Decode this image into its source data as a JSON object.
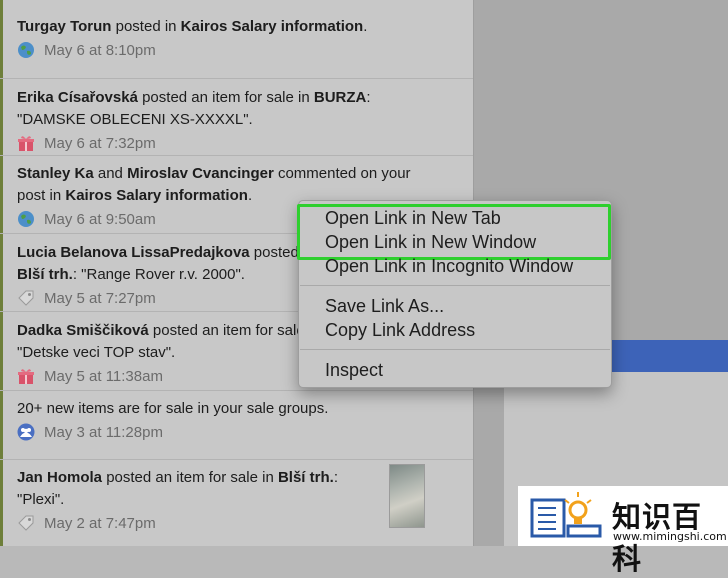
{
  "notifications": [
    {
      "actors": [
        "Turgay Torun"
      ],
      "connectors": [
        " posted in "
      ],
      "group": "Kairos Salary information",
      "tail": ".",
      "time": "May 6 at 8:10pm",
      "icon": "globe-icon"
    },
    {
      "actors": [
        "Erika Císařovská"
      ],
      "connectors": [
        " posted an item for sale in "
      ],
      "group": "BURZA",
      "tail": ":",
      "line2": "\"DAMSKE OBLECENI XS-XXXXL\".",
      "time": "May 6 at 7:32pm",
      "icon": "gift-icon"
    },
    {
      "actors": [
        "Stanley Ka",
        "Miroslav Cvancinger"
      ],
      "connectors": [
        " and ",
        " commented on your"
      ],
      "line2_prefix": "post in ",
      "group": "Kairos Salary information",
      "tail": ".",
      "time": "May 6 at 9:50am",
      "icon": "globe-icon"
    },
    {
      "actors": [
        "Lucia Belanova",
        "LissaPredajkova"
      ],
      "connectors": [
        " ",
        " posted"
      ],
      "group": "Blší trh.",
      "tail": ": \"Range Rover r.v. 2000\".",
      "time": "May 5 at 7:27pm",
      "icon": "tag-icon"
    },
    {
      "actors": [
        "Dadka Smiščiková"
      ],
      "connectors": [
        " posted an item for sale"
      ],
      "line2": "\"Detske veci TOP stav\".",
      "time": "May 5 at 11:38am",
      "icon": "gift-icon"
    },
    {
      "text": "20+ new items are for sale in your sale groups.",
      "time": "May 3 at 11:28pm",
      "icon": "group-icon"
    },
    {
      "actors": [
        "Jan Homola"
      ],
      "connectors": [
        " posted an item for sale in "
      ],
      "group": "Blší trh.",
      "tail": ":",
      "line2": "\"Plexi\".",
      "time": "May 2 at 7:47pm",
      "icon": "tag-icon"
    }
  ],
  "context_menu": {
    "items": [
      "Open Link in New Tab",
      "Open Link in New Window",
      "Open Link in Incognito Window",
      "Save Link As...",
      "Copy Link Address",
      "Inspect"
    ]
  },
  "watermark": {
    "brand": "知识百科",
    "url": "www.mimingshi.com"
  },
  "colors": {
    "highlight": "#2ecf2e",
    "accent_blue": "#3d63b8"
  }
}
